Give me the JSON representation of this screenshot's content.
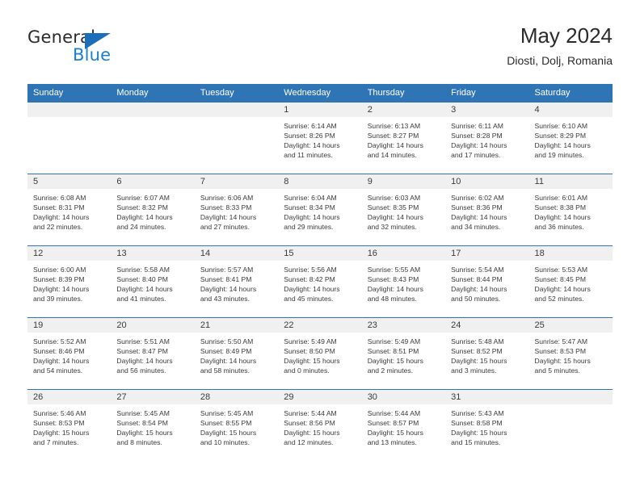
{
  "brand": {
    "line1": "General",
    "line2": "Blue",
    "triangle_icon": "triangle-icon",
    "color_dark": "#2b2b2b",
    "color_blue": "#1b7fd4"
  },
  "header": {
    "title": "May 2024",
    "subtitle": "Diosti, Dolj, Romania"
  },
  "theme": {
    "header_blue": "#2f74b5",
    "band_gray": "#f0f0f0",
    "text": "#3a3a3a"
  },
  "weekday_headers": [
    "Sunday",
    "Monday",
    "Tuesday",
    "Wednesday",
    "Thursday",
    "Friday",
    "Saturday"
  ],
  "labels": {
    "sunrise": "Sunrise:",
    "sunset": "Sunset:",
    "daylight": "Daylight:"
  },
  "weeks": [
    [
      {
        "day": "",
        "sunrise": "",
        "sunset": "",
        "daylight1": "",
        "daylight2": ""
      },
      {
        "day": "",
        "sunrise": "",
        "sunset": "",
        "daylight1": "",
        "daylight2": ""
      },
      {
        "day": "",
        "sunrise": "",
        "sunset": "",
        "daylight1": "",
        "daylight2": ""
      },
      {
        "day": "1",
        "sunrise": "Sunrise: 6:14 AM",
        "sunset": "Sunset: 8:26 PM",
        "daylight1": "Daylight: 14 hours",
        "daylight2": "and 11 minutes."
      },
      {
        "day": "2",
        "sunrise": "Sunrise: 6:13 AM",
        "sunset": "Sunset: 8:27 PM",
        "daylight1": "Daylight: 14 hours",
        "daylight2": "and 14 minutes."
      },
      {
        "day": "3",
        "sunrise": "Sunrise: 6:11 AM",
        "sunset": "Sunset: 8:28 PM",
        "daylight1": "Daylight: 14 hours",
        "daylight2": "and 17 minutes."
      },
      {
        "day": "4",
        "sunrise": "Sunrise: 6:10 AM",
        "sunset": "Sunset: 8:29 PM",
        "daylight1": "Daylight: 14 hours",
        "daylight2": "and 19 minutes."
      }
    ],
    [
      {
        "day": "5",
        "sunrise": "Sunrise: 6:08 AM",
        "sunset": "Sunset: 8:31 PM",
        "daylight1": "Daylight: 14 hours",
        "daylight2": "and 22 minutes."
      },
      {
        "day": "6",
        "sunrise": "Sunrise: 6:07 AM",
        "sunset": "Sunset: 8:32 PM",
        "daylight1": "Daylight: 14 hours",
        "daylight2": "and 24 minutes."
      },
      {
        "day": "7",
        "sunrise": "Sunrise: 6:06 AM",
        "sunset": "Sunset: 8:33 PM",
        "daylight1": "Daylight: 14 hours",
        "daylight2": "and 27 minutes."
      },
      {
        "day": "8",
        "sunrise": "Sunrise: 6:04 AM",
        "sunset": "Sunset: 8:34 PM",
        "daylight1": "Daylight: 14 hours",
        "daylight2": "and 29 minutes."
      },
      {
        "day": "9",
        "sunrise": "Sunrise: 6:03 AM",
        "sunset": "Sunset: 8:35 PM",
        "daylight1": "Daylight: 14 hours",
        "daylight2": "and 32 minutes."
      },
      {
        "day": "10",
        "sunrise": "Sunrise: 6:02 AM",
        "sunset": "Sunset: 8:36 PM",
        "daylight1": "Daylight: 14 hours",
        "daylight2": "and 34 minutes."
      },
      {
        "day": "11",
        "sunrise": "Sunrise: 6:01 AM",
        "sunset": "Sunset: 8:38 PM",
        "daylight1": "Daylight: 14 hours",
        "daylight2": "and 36 minutes."
      }
    ],
    [
      {
        "day": "12",
        "sunrise": "Sunrise: 6:00 AM",
        "sunset": "Sunset: 8:39 PM",
        "daylight1": "Daylight: 14 hours",
        "daylight2": "and 39 minutes."
      },
      {
        "day": "13",
        "sunrise": "Sunrise: 5:58 AM",
        "sunset": "Sunset: 8:40 PM",
        "daylight1": "Daylight: 14 hours",
        "daylight2": "and 41 minutes."
      },
      {
        "day": "14",
        "sunrise": "Sunrise: 5:57 AM",
        "sunset": "Sunset: 8:41 PM",
        "daylight1": "Daylight: 14 hours",
        "daylight2": "and 43 minutes."
      },
      {
        "day": "15",
        "sunrise": "Sunrise: 5:56 AM",
        "sunset": "Sunset: 8:42 PM",
        "daylight1": "Daylight: 14 hours",
        "daylight2": "and 45 minutes."
      },
      {
        "day": "16",
        "sunrise": "Sunrise: 5:55 AM",
        "sunset": "Sunset: 8:43 PM",
        "daylight1": "Daylight: 14 hours",
        "daylight2": "and 48 minutes."
      },
      {
        "day": "17",
        "sunrise": "Sunrise: 5:54 AM",
        "sunset": "Sunset: 8:44 PM",
        "daylight1": "Daylight: 14 hours",
        "daylight2": "and 50 minutes."
      },
      {
        "day": "18",
        "sunrise": "Sunrise: 5:53 AM",
        "sunset": "Sunset: 8:45 PM",
        "daylight1": "Daylight: 14 hours",
        "daylight2": "and 52 minutes."
      }
    ],
    [
      {
        "day": "19",
        "sunrise": "Sunrise: 5:52 AM",
        "sunset": "Sunset: 8:46 PM",
        "daylight1": "Daylight: 14 hours",
        "daylight2": "and 54 minutes."
      },
      {
        "day": "20",
        "sunrise": "Sunrise: 5:51 AM",
        "sunset": "Sunset: 8:47 PM",
        "daylight1": "Daylight: 14 hours",
        "daylight2": "and 56 minutes."
      },
      {
        "day": "21",
        "sunrise": "Sunrise: 5:50 AM",
        "sunset": "Sunset: 8:49 PM",
        "daylight1": "Daylight: 14 hours",
        "daylight2": "and 58 minutes."
      },
      {
        "day": "22",
        "sunrise": "Sunrise: 5:49 AM",
        "sunset": "Sunset: 8:50 PM",
        "daylight1": "Daylight: 15 hours",
        "daylight2": "and 0 minutes."
      },
      {
        "day": "23",
        "sunrise": "Sunrise: 5:49 AM",
        "sunset": "Sunset: 8:51 PM",
        "daylight1": "Daylight: 15 hours",
        "daylight2": "and 2 minutes."
      },
      {
        "day": "24",
        "sunrise": "Sunrise: 5:48 AM",
        "sunset": "Sunset: 8:52 PM",
        "daylight1": "Daylight: 15 hours",
        "daylight2": "and 3 minutes."
      },
      {
        "day": "25",
        "sunrise": "Sunrise: 5:47 AM",
        "sunset": "Sunset: 8:53 PM",
        "daylight1": "Daylight: 15 hours",
        "daylight2": "and 5 minutes."
      }
    ],
    [
      {
        "day": "26",
        "sunrise": "Sunrise: 5:46 AM",
        "sunset": "Sunset: 8:53 PM",
        "daylight1": "Daylight: 15 hours",
        "daylight2": "and 7 minutes."
      },
      {
        "day": "27",
        "sunrise": "Sunrise: 5:45 AM",
        "sunset": "Sunset: 8:54 PM",
        "daylight1": "Daylight: 15 hours",
        "daylight2": "and 8 minutes."
      },
      {
        "day": "28",
        "sunrise": "Sunrise: 5:45 AM",
        "sunset": "Sunset: 8:55 PM",
        "daylight1": "Daylight: 15 hours",
        "daylight2": "and 10 minutes."
      },
      {
        "day": "29",
        "sunrise": "Sunrise: 5:44 AM",
        "sunset": "Sunset: 8:56 PM",
        "daylight1": "Daylight: 15 hours",
        "daylight2": "and 12 minutes."
      },
      {
        "day": "30",
        "sunrise": "Sunrise: 5:44 AM",
        "sunset": "Sunset: 8:57 PM",
        "daylight1": "Daylight: 15 hours",
        "daylight2": "and 13 minutes."
      },
      {
        "day": "31",
        "sunrise": "Sunrise: 5:43 AM",
        "sunset": "Sunset: 8:58 PM",
        "daylight1": "Daylight: 15 hours",
        "daylight2": "and 15 minutes."
      },
      {
        "day": "",
        "sunrise": "",
        "sunset": "",
        "daylight1": "",
        "daylight2": ""
      }
    ]
  ]
}
